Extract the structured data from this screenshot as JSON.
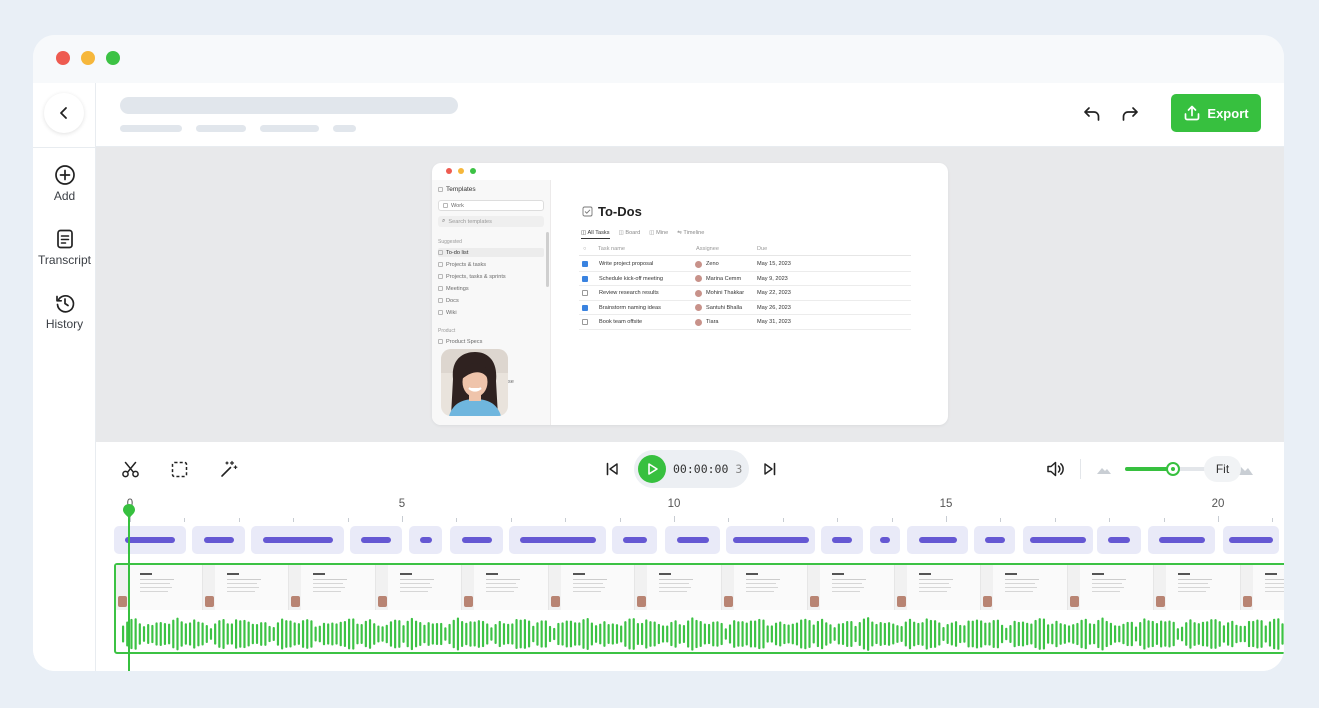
{
  "window": {
    "traffic_colors": [
      "#ee5b50",
      "#f6b73b",
      "#3cc244"
    ]
  },
  "sidebar": {
    "back_icon": "chevron-left-icon",
    "items": [
      {
        "label": "Add",
        "icon": "plus-circle-icon"
      },
      {
        "label": "Transcript",
        "icon": "document-icon"
      },
      {
        "label": "History",
        "icon": "history-icon"
      }
    ]
  },
  "header": {
    "undo_icon": "undo-icon",
    "redo_icon": "redo-icon",
    "export_label": "Export",
    "export_icon": "upload-icon",
    "accent_color": "#37c03f"
  },
  "preview": {
    "sidebar": {
      "title": "Templates",
      "workspace": "Work",
      "search_placeholder": "Search templates",
      "section_suggested": "Suggested",
      "suggested": [
        "To-do list",
        "Projects & tasks",
        "Projects, tasks & sprints",
        "Meetings",
        "Docs",
        "Wiki"
      ],
      "section_product": "Product",
      "product": [
        "Product Specs"
      ],
      "partial_text": "se"
    },
    "page_title": "To-Dos",
    "views": [
      "All Tasks",
      "Board",
      "Mine",
      "Timeline"
    ],
    "columns": [
      "Task name",
      "Assignee",
      "Due"
    ],
    "rows": [
      {
        "task": "Write project proposal",
        "assignee": "Zeno",
        "due": "May 15, 2023",
        "checked": true
      },
      {
        "task": "Schedule kick-off meeting",
        "assignee": "Marina Cemm",
        "due": "May 9, 2023",
        "checked": true
      },
      {
        "task": "Review research results",
        "assignee": "Mohini Thakkar",
        "due": "May 22, 2023",
        "checked": false
      },
      {
        "task": "Brainstorm naming ideas",
        "assignee": "Santuhi Bhalla",
        "due": "May 26, 2023",
        "checked": true
      },
      {
        "task": "Book team offsite",
        "assignee": "Tiara",
        "due": "May 31, 2023",
        "checked": false
      }
    ]
  },
  "timeline": {
    "tools": [
      "scissors-icon",
      "select-box-icon",
      "magic-wand-icon"
    ],
    "timecode": "00:00:00",
    "timecode_frame": "3",
    "volume_icon": "speaker-icon",
    "zoom_level": 0.49,
    "fit_label": "Fit",
    "ruler": [
      "0",
      "5",
      "10",
      "15",
      "20"
    ],
    "caption_segments": 20,
    "frame_count": 14,
    "playhead_seconds": 0
  }
}
